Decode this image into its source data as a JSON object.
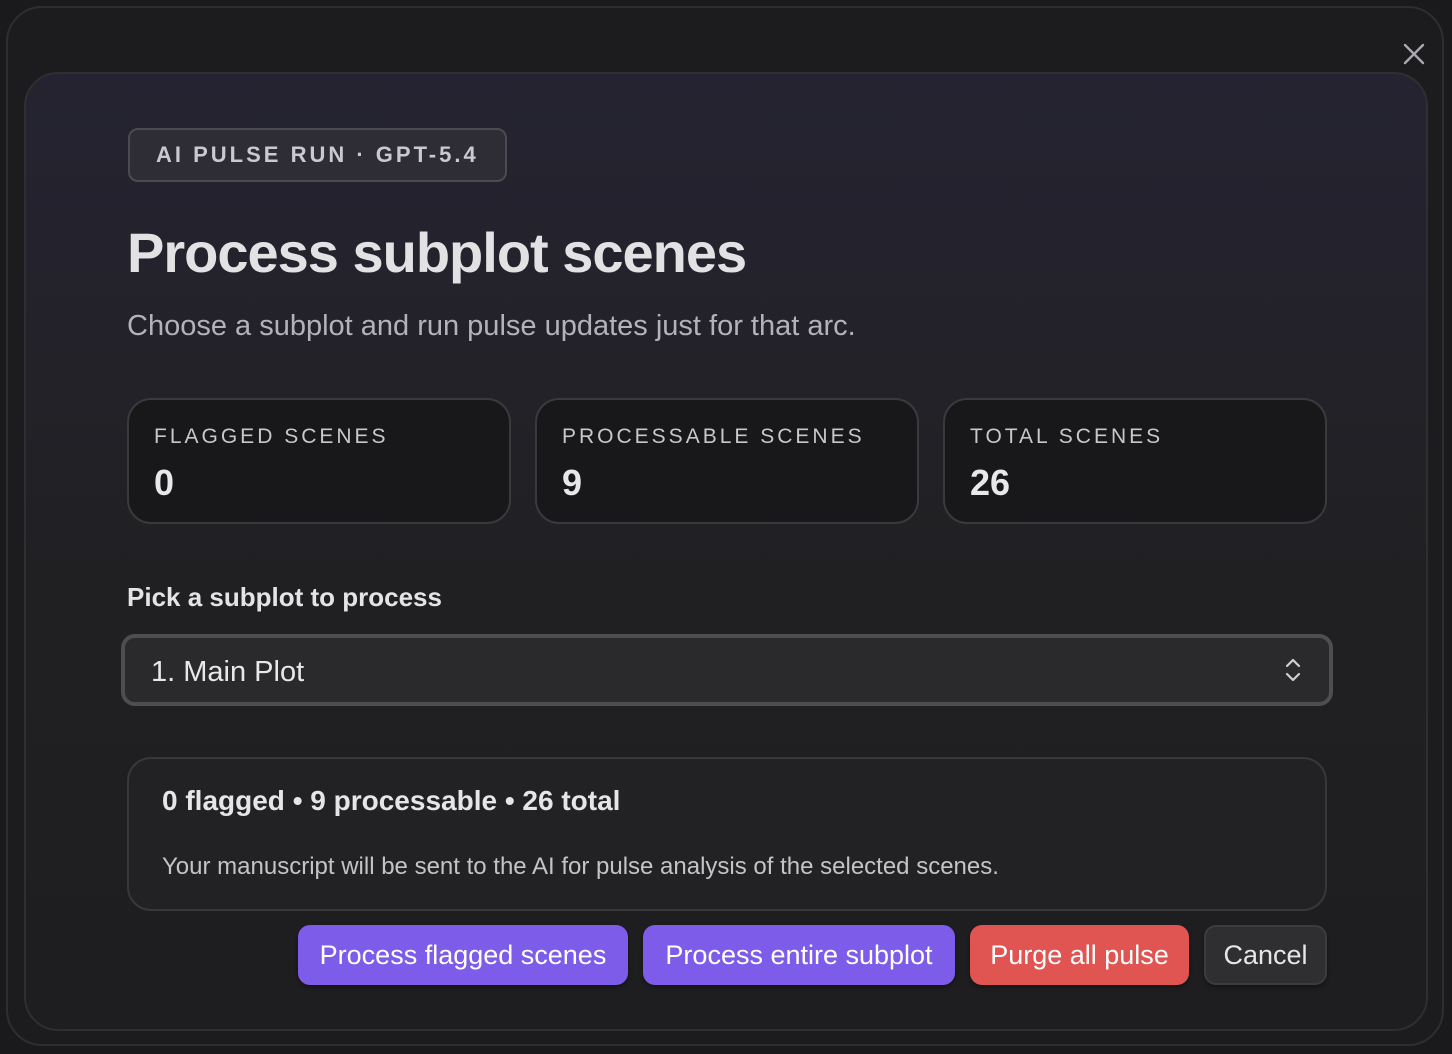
{
  "modal": {
    "badge": "AI PULSE RUN · GPT-5.4",
    "title": "Process subplot scenes",
    "subtitle": "Choose a subplot and run pulse updates just for that arc."
  },
  "stats": [
    {
      "label": "FLAGGED SCENES",
      "value": "0"
    },
    {
      "label": "PROCESSABLE SCENES",
      "value": "9"
    },
    {
      "label": "TOTAL SCENES",
      "value": "26"
    }
  ],
  "picker": {
    "label": "Pick a subplot to process",
    "selected": "1. Main Plot"
  },
  "summary": {
    "stats_line": "0 flagged • 9 processable • 26 total",
    "note": "Your manuscript will be sent to the AI for pulse analysis of the selected scenes."
  },
  "buttons": {
    "process_flagged": "Process flagged scenes",
    "process_subplot": "Process entire subplot",
    "purge": "Purge all pulse",
    "cancel": "Cancel"
  },
  "colors": {
    "accent_purple": "#7c5ce8",
    "danger_red": "#e05451",
    "background": "#1c1c1e"
  },
  "icons": {
    "close": "close-icon",
    "select": "chevron-up-down-icon"
  }
}
